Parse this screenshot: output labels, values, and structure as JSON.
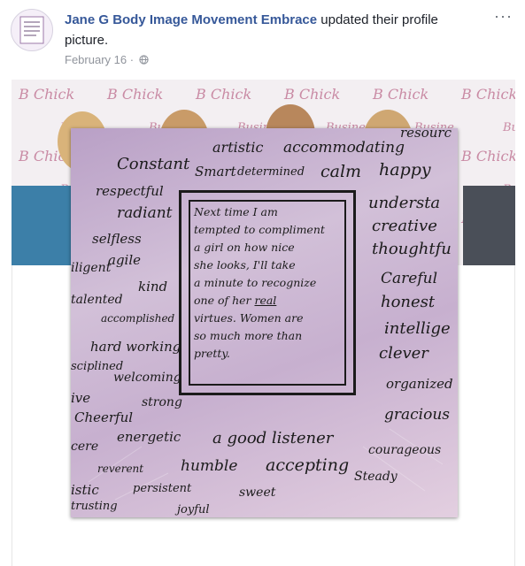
{
  "post": {
    "author": "Jane G Body Image Movement Embrace",
    "action": "updated their profile picture.",
    "date": "February 16",
    "privacy_icon": "globe-icon",
    "menu_icon": "more-icon",
    "menu_label": "···"
  },
  "cover": {
    "wall_text": "Business Chicks"
  },
  "card": {
    "center_text": [
      "Next time I am",
      "tempted to compliment",
      "a girl on how nice",
      "she looks, I'll take",
      "a minute to recognize",
      "one of her",
      "virtues. Women are",
      "so much more than",
      "pretty."
    ],
    "center_underlined": "real",
    "words": [
      "artistic",
      "accommodating",
      "resourc",
      "Constant",
      "Smart",
      "determined",
      "calm",
      "happy",
      "respectful",
      "radiant",
      "understa",
      "creative",
      "selfless",
      "thoughtfu",
      "agile",
      "iligent",
      "kind",
      "Careful",
      "talented",
      "honest",
      "accomplished",
      "intellige",
      "hard working",
      "sciplined",
      "clever",
      "welcoming",
      "organized",
      "ive",
      "strong",
      "Cheerful",
      "gracious",
      "cere",
      "energetic",
      "a good listener",
      "courageous",
      "reverent",
      "humble",
      "accepting",
      "Steady",
      "istic",
      "persistent",
      "sweet",
      "trusting",
      "joyful"
    ]
  }
}
